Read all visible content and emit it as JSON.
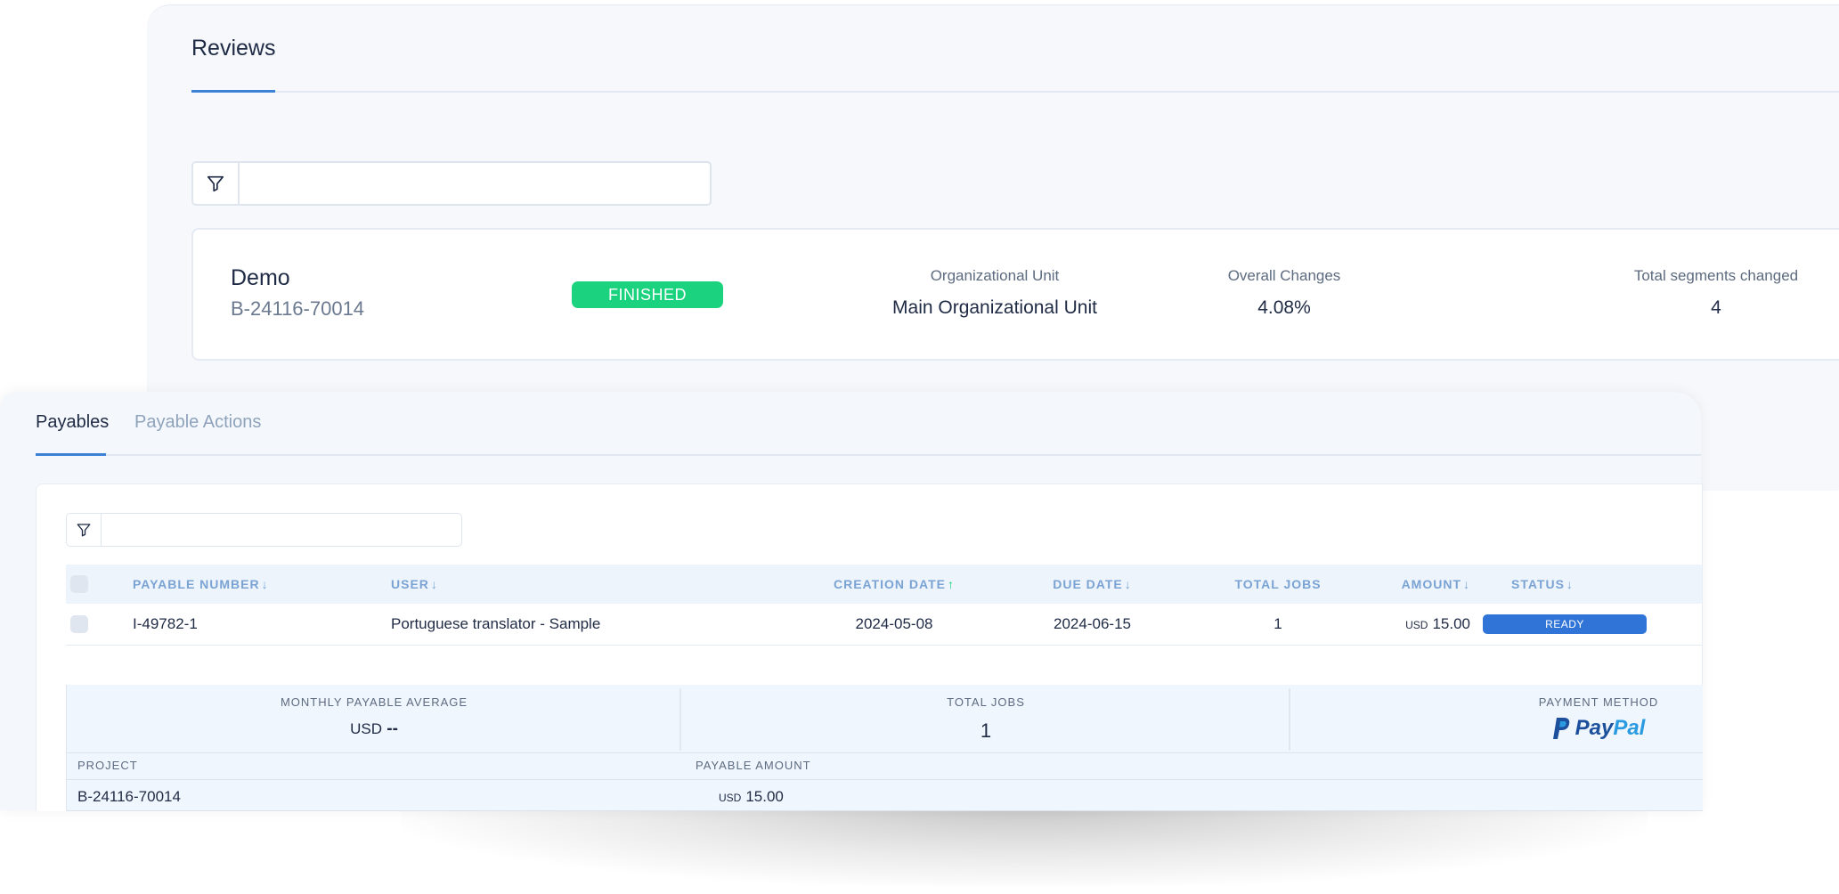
{
  "reviews": {
    "title": "Reviews",
    "search": {
      "value": "",
      "placeholder": ""
    },
    "card": {
      "name": "Demo",
      "id": "B-24116-70014",
      "status": "FINISHED",
      "stats": [
        {
          "label": "Organizational Unit",
          "value": "Main Organizational Unit"
        },
        {
          "label": "Overall Changes",
          "value": "4.08%"
        },
        {
          "label": "Total segments changed",
          "value": "4"
        }
      ]
    }
  },
  "payables": {
    "tabs": [
      {
        "label": "Payables",
        "active": true
      },
      {
        "label": "Payable Actions",
        "active": false
      }
    ],
    "search": {
      "value": "",
      "placeholder": ""
    },
    "table": {
      "columns": [
        {
          "label": "PAYABLE NUMBER",
          "sort": "down"
        },
        {
          "label": "USER",
          "sort": "down"
        },
        {
          "label": "CREATION DATE",
          "sort": "up"
        },
        {
          "label": "DUE DATE",
          "sort": "down"
        },
        {
          "label": "TOTAL JOBS",
          "sort": ""
        },
        {
          "label": "AMOUNT",
          "sort": "down"
        },
        {
          "label": "STATUS",
          "sort": "down"
        }
      ],
      "rows": [
        {
          "number": "I-49782-1",
          "user": "Portuguese translator - Sample",
          "creation_date": "2024-05-08",
          "due_date": "2024-06-15",
          "total_jobs": "1",
          "amount_currency": "USD",
          "amount": "15.00",
          "status": "READY"
        }
      ]
    },
    "details": {
      "monthly_avg_label": "MONTHLY PAYABLE AVERAGE",
      "monthly_avg_currency": "USD",
      "monthly_avg_value": "--",
      "total_jobs_label": "TOTAL JOBS",
      "total_jobs_value": "1",
      "payment_method_label": "PAYMENT METHOD",
      "payment_method_brand_1": "Pay",
      "payment_method_brand_2": "Pal",
      "project_label": "PROJECT",
      "payable_amount_label": "PAYABLE AMOUNT",
      "project_value": "B-24116-70014",
      "payable_amount_currency": "USD",
      "payable_amount_value": "15.00"
    }
  },
  "colors": {
    "accent": "#3b82d6",
    "finished": "#1bd37e",
    "ready": "#2f74d6",
    "header_text": "#7aa3d4"
  },
  "icons": [
    "filter-icon",
    "sort-arrow-icon",
    "paypal-logo"
  ]
}
